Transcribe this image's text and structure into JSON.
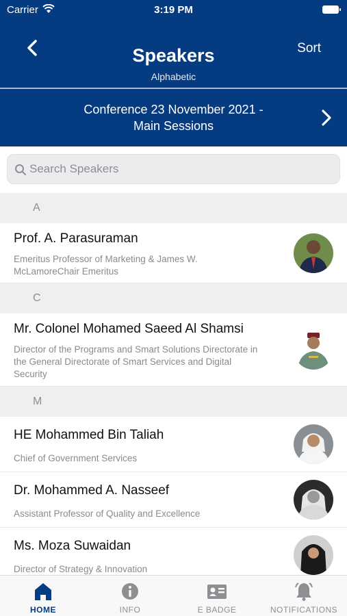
{
  "status": {
    "carrier": "Carrier",
    "time": "3:19 PM"
  },
  "nav": {
    "title": "Speakers",
    "subtitle": "Alphabetic",
    "sort_label": "Sort"
  },
  "session": {
    "line1": "Conference 23 November 2021 -",
    "line2": "Main Sessions"
  },
  "search": {
    "placeholder": "Search Speakers"
  },
  "sections": [
    {
      "letter": "A",
      "speakers": [
        {
          "name": "Prof. A. Parasuraman",
          "role": [
            "Emeritus Professor of Marketing & James W.",
            "McLamoreChair Emeritus"
          ]
        }
      ]
    },
    {
      "letter": "C",
      "speakers": [
        {
          "name": "Mr. Colonel Mohamed Saeed Al Shamsi",
          "role": [
            "Director of the Programs and Smart Solutions Directorate in",
            "the General Directorate of Smart Services and Digital",
            "Security"
          ]
        }
      ]
    },
    {
      "letter": "M",
      "speakers": [
        {
          "name": "HE Mohammed Bin Taliah",
          "role": [
            "Chief of Government Services"
          ]
        },
        {
          "name": "Dr. Mohammed A. Nasseef",
          "role": [
            "Assistant Professor of Quality and Excellence"
          ]
        },
        {
          "name": "Ms. Moza Suwaidan",
          "role": [
            "Director of Strategy & Innovation"
          ]
        }
      ]
    }
  ],
  "tabs": [
    {
      "label": "HOME",
      "icon": "home-icon",
      "active": true
    },
    {
      "label": "INFO",
      "icon": "info-icon",
      "active": false
    },
    {
      "label": "E BADGE",
      "icon": "badge-icon",
      "active": false
    },
    {
      "label": "NOTIFICATIONS",
      "icon": "bell-icon",
      "active": false
    }
  ],
  "colors": {
    "primary": "#053b80",
    "background": "#f2f2f2",
    "muted": "#8e8e93"
  }
}
